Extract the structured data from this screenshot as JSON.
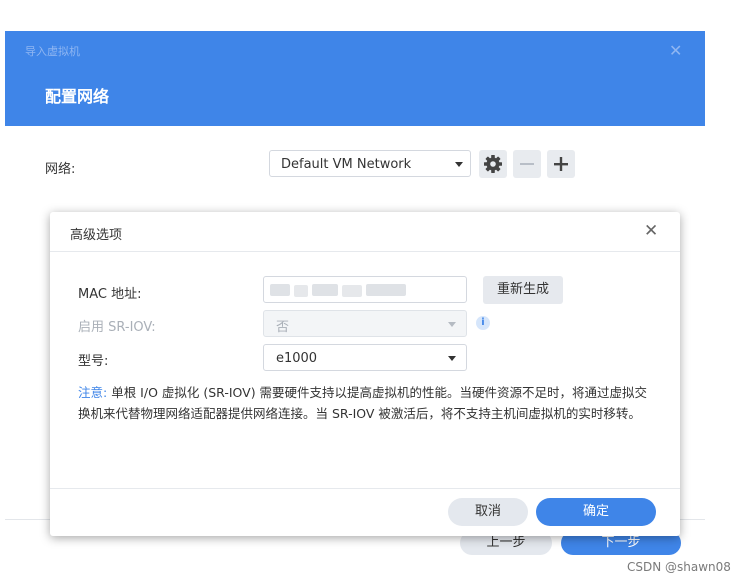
{
  "wizard": {
    "title": "导入虚拟机",
    "subtitle": "配置网络",
    "network_label": "网络:",
    "network_value": "Default VM Network",
    "prev_label": "上一步",
    "next_label": "下一步"
  },
  "dialog": {
    "title": "高级选项",
    "mac_label": "MAC 地址:",
    "regenerate_label": "重新生成",
    "sriov_label": "启用 SR-IOV:",
    "sriov_value": "否",
    "model_label": "型号:",
    "model_value": "e1000",
    "note_prefix": "注意:",
    "note_text": " 单根 I/O 虚拟化 (SR-IOV) 需要硬件支持以提高虚拟机的性能。当硬件资源不足时，将通过虚拟交换机来代替物理网络适配器提供网络连接。当 SR-IOV 被激活后，将不支持主机间虚拟机的实时移转。",
    "cancel_label": "取消",
    "ok_label": "确定"
  },
  "watermark": "CSDN @shawn08",
  "icons": {
    "close": "close-icon",
    "gear": "gear-icon",
    "minus": "minus-icon",
    "plus": "plus-icon",
    "info": "info-icon",
    "dropdown": "chevron-down-icon"
  },
  "colors": {
    "accent": "#3f85e8",
    "header_bg": "#3f85e8",
    "secondary_button": "#e4e8ee"
  }
}
